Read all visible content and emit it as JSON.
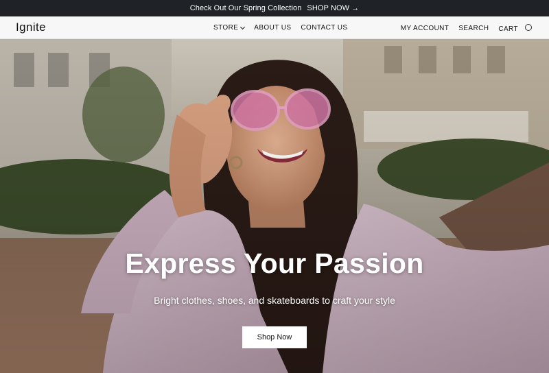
{
  "announcement": {
    "text": "Check Out Our Spring Collection",
    "cta": "SHOP NOW",
    "arrow_icon": "arrow-right-icon"
  },
  "header": {
    "logo": "Ignite",
    "nav": [
      {
        "label": "STORE",
        "has_dropdown": true
      },
      {
        "label": "ABOUT US"
      },
      {
        "label": "CONTACT US"
      }
    ],
    "account": "MY ACCOUNT",
    "search": "SEARCH",
    "cart": "CART",
    "cart_icon": "cart-circle-icon"
  },
  "hero": {
    "title": "Express Your Passion",
    "subtitle": "Bright clothes, shoes, and skateboards to craft your style",
    "button": "Shop Now",
    "image": "photo-woman-pink-sunglasses-selfie"
  },
  "colors": {
    "announcement_bg": "#1f2327",
    "header_bg": "#f7f7f7",
    "button_bg": "#ffffff",
    "text_dark": "#111111"
  }
}
